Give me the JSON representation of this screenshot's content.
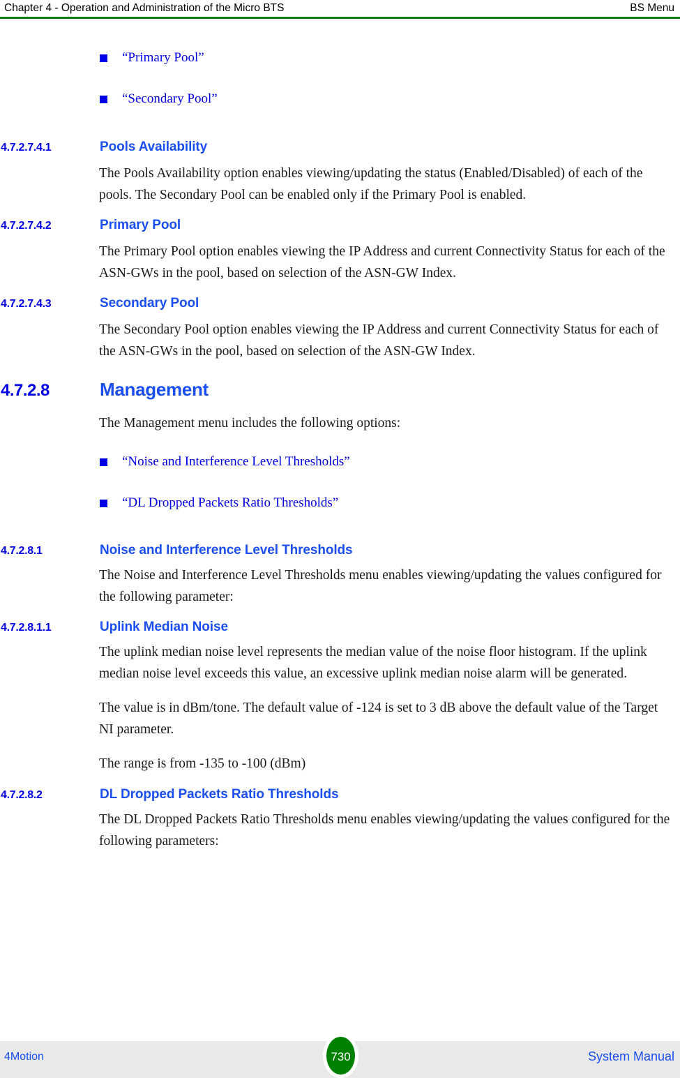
{
  "header": {
    "left": "Chapter 4 - Operation and Administration of the Micro BTS",
    "right": "BS Menu",
    "rule_color": "#008000"
  },
  "colors": {
    "link_blue": "#0000e6",
    "heading_blue": "#1a4ef0",
    "rule_green": "#008000",
    "footer_band": "#e9e9e9",
    "page_disc_green": "#008000"
  },
  "top_links": [
    {
      "label": "“Primary Pool”"
    },
    {
      "label": "“Secondary Pool”"
    }
  ],
  "sections": [
    {
      "number": "4.7.2.7.4.1",
      "title": "Pools Availability",
      "level": 4,
      "paragraphs": [
        "The Pools Availability option enables viewing/updating the status (Enabled/Disabled) of each of the pools. The Secondary Pool can be enabled only if the Primary Pool is enabled."
      ]
    },
    {
      "number": "4.7.2.7.4.2",
      "title": "Primary Pool",
      "level": 4,
      "paragraphs": [
        "The Primary Pool option enables viewing the IP Address and current Connectivity Status for each of the ASN-GWs in the pool, based on selection of the ASN-GW Index."
      ]
    },
    {
      "number": "4.7.2.7.4.3",
      "title": "Secondary Pool",
      "level": 4,
      "paragraphs": [
        "The Secondary Pool option enables viewing the IP Address and current Connectivity Status for each of the ASN-GWs in the pool, based on selection of the ASN-GW Index."
      ]
    },
    {
      "number": "4.7.2.8",
      "title": "Management",
      "level": 3,
      "paragraphs": [
        "The Management menu includes the following options:"
      ]
    },
    {
      "number": "4.7.2.8.1",
      "title": "Noise and Interference Level Thresholds",
      "level": 4,
      "paragraphs": [
        "The Noise and Interference Level Thresholds menu enables viewing/updating the values configured for the following parameter:"
      ]
    },
    {
      "number": "4.7.2.8.1.1",
      "title": "Uplink Median Noise",
      "level": 4,
      "paragraphs": [
        "The uplink median noise level represents the median value of the noise floor histogram. If the uplink median noise level exceeds this value, an excessive uplink median noise alarm will be generated.",
        "The value is in dBm/tone. The default value of -124 is set to 3 dB above the default value of the Target NI parameter.",
        "The range is from -135 to -100 (dBm)"
      ]
    },
    {
      "number": "4.7.2.8.2",
      "title": "DL Dropped Packets Ratio Thresholds",
      "level": 4,
      "paragraphs": [
        "The DL Dropped Packets Ratio Thresholds menu enables viewing/updating the values configured for the following parameters:"
      ]
    }
  ],
  "management_links": [
    {
      "label": "“Noise and Interference Level Thresholds”"
    },
    {
      "label": "“DL Dropped Packets Ratio Thresholds”"
    }
  ],
  "footer": {
    "left": "4Motion",
    "page_number": "730",
    "right": "System Manual"
  }
}
